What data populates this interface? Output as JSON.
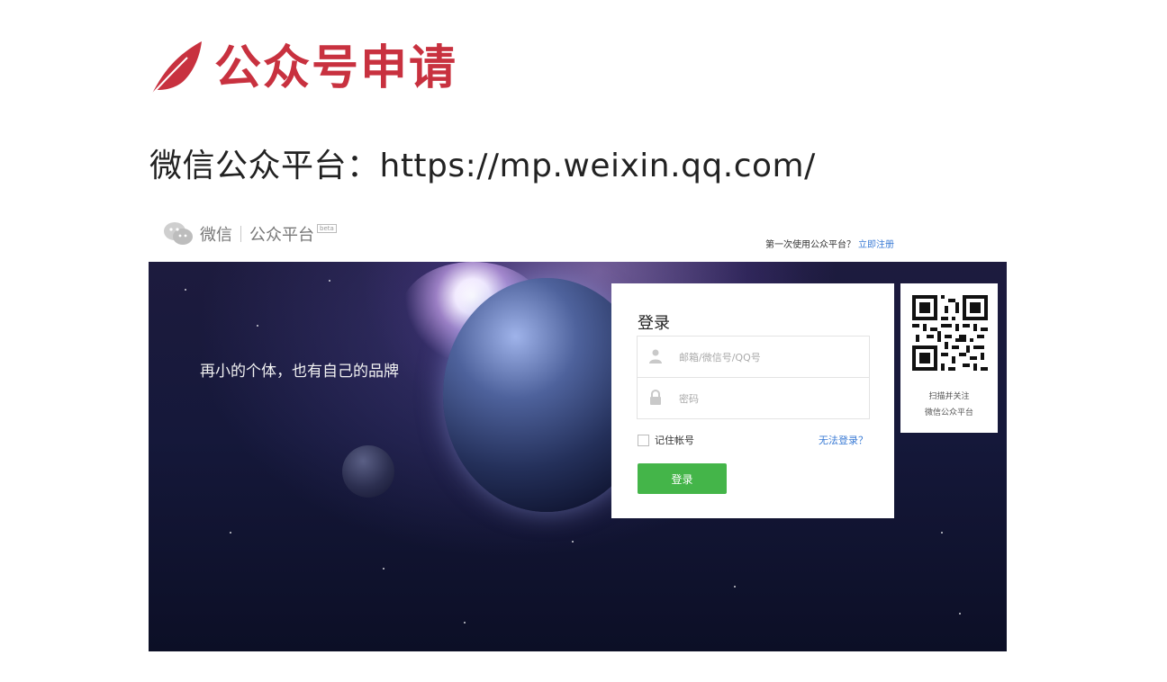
{
  "slide": {
    "title": "公众号申请",
    "subtitle": "微信公众平台：https://mp.weixin.qq.com/",
    "accent_color": "#c8313f",
    "title_icon": "leaf-icon"
  },
  "wechat_page": {
    "header": {
      "brand": "微信",
      "platform": "公众平台",
      "badge": "beta",
      "register_prompt": "第一次使用公众平台？",
      "register_link": "立即注册"
    },
    "banner": {
      "tagline": "再小的个体，也有自己的品牌"
    },
    "login": {
      "title": "登录",
      "account_placeholder": "邮箱/微信号/QQ号",
      "password_placeholder": "密码",
      "remember_label": "记住帐号",
      "remember_checked": false,
      "forgot_link": "无法登录？",
      "submit_label": "登录",
      "submit_color": "#44b549",
      "link_color": "#3a7bd5"
    },
    "qr": {
      "caption_line1": "扫描并关注",
      "caption_line2": "微信公众平台"
    }
  }
}
